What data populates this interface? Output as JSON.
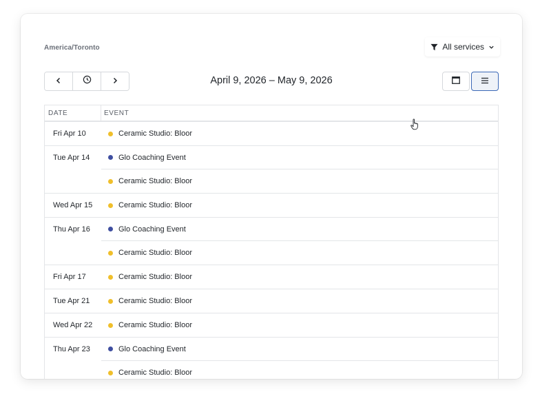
{
  "timezone": "America/Toronto",
  "filter": {
    "label": "All services",
    "icon": "filter-icon"
  },
  "navigation": {
    "prev_icon": "chevron-left-icon",
    "today_icon": "clock-icon",
    "next_icon": "chevron-right-icon"
  },
  "range_title": "April 9, 2026 – May 9, 2026",
  "views": [
    {
      "name": "calendar-view",
      "icon": "calendar-icon",
      "active": false
    },
    {
      "name": "list-view",
      "icon": "list-icon",
      "active": true
    }
  ],
  "table": {
    "headers": {
      "date": "DATE",
      "event": "EVENT"
    },
    "colors": {
      "ceramic": "#f0bf2b",
      "glo": "#3f4ea0"
    },
    "rows": [
      {
        "date": "Fri Apr 10",
        "event": "Ceramic Studio: Bloor",
        "color": "ceramic",
        "first": true,
        "last": true
      },
      {
        "date": "Tue Apr 14",
        "event": "Glo Coaching Event",
        "color": "glo",
        "first": true,
        "last": false
      },
      {
        "date": "",
        "event": "Ceramic Studio: Bloor",
        "color": "ceramic",
        "first": false,
        "last": true
      },
      {
        "date": "Wed Apr 15",
        "event": "Ceramic Studio: Bloor",
        "color": "ceramic",
        "first": true,
        "last": true
      },
      {
        "date": "Thu Apr 16",
        "event": "Glo Coaching Event",
        "color": "glo",
        "first": true,
        "last": false
      },
      {
        "date": "",
        "event": "Ceramic Studio: Bloor",
        "color": "ceramic",
        "first": false,
        "last": true
      },
      {
        "date": "Fri Apr 17",
        "event": "Ceramic Studio: Bloor",
        "color": "ceramic",
        "first": true,
        "last": true
      },
      {
        "date": "Tue Apr 21",
        "event": "Ceramic Studio: Bloor",
        "color": "ceramic",
        "first": true,
        "last": true
      },
      {
        "date": "Wed Apr 22",
        "event": "Ceramic Studio: Bloor",
        "color": "ceramic",
        "first": true,
        "last": true
      },
      {
        "date": "Thu Apr 23",
        "event": "Glo Coaching Event",
        "color": "glo",
        "first": true,
        "last": false
      },
      {
        "date": "",
        "event": "Ceramic Studio: Bloor",
        "color": "ceramic",
        "first": false,
        "last": true
      }
    ]
  }
}
